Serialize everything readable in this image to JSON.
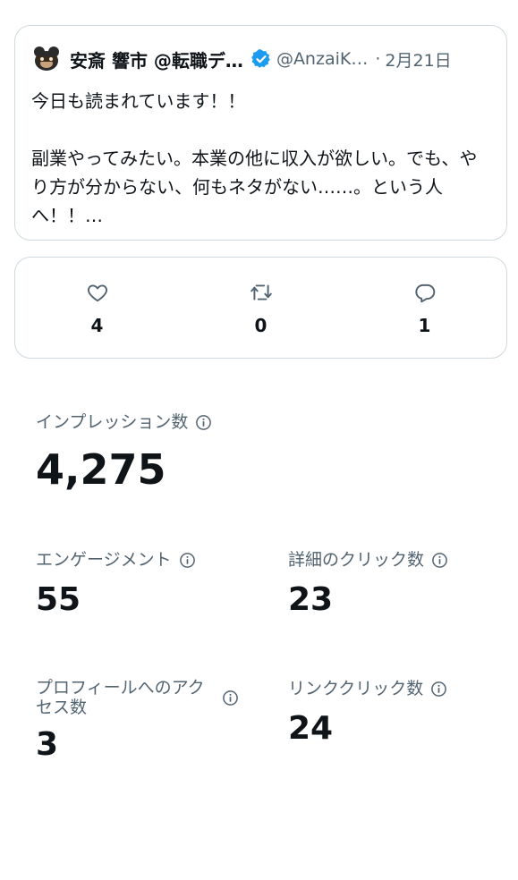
{
  "tweet": {
    "author_name": "安斎 響市 @転職デ…",
    "handle": "@AnzaiK…",
    "separator": "·",
    "date": "2月21日",
    "line1": "今日も読まれています！！",
    "line2": "副業やってみたい。本業の他に収入が欲しい。でも、やり方が分からない、何もネタがない……。という人へ！！…",
    "verified_color": "#1d9bf0"
  },
  "actions": {
    "likes": "4",
    "retweets": "0",
    "replies": "1"
  },
  "metrics": {
    "impressions": {
      "label": "インプレッション数",
      "value": "4,275"
    },
    "engagements": {
      "label": "エンゲージメント",
      "value": "55"
    },
    "detail_clicks": {
      "label": "詳細のクリック数",
      "value": "23"
    },
    "profile_visits": {
      "label": "プロフィールへのアクセス数",
      "value": "3"
    },
    "link_clicks": {
      "label": "リンククリック数",
      "value": "24"
    }
  }
}
